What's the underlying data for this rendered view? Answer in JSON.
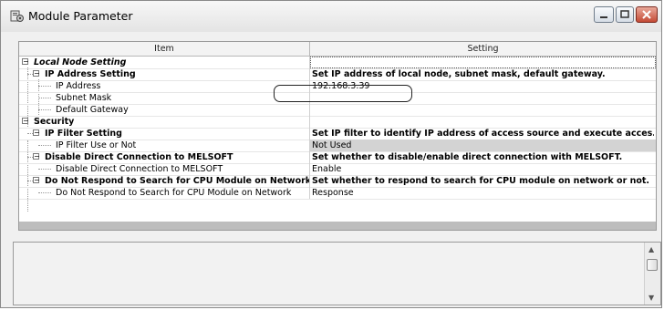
{
  "window": {
    "title": "Module Parameter",
    "icon": "module-parameter-icon"
  },
  "grid": {
    "header": {
      "item": "Item",
      "setting": "Setting"
    },
    "rows": [
      {
        "label": "Local Node Setting",
        "setting": ""
      },
      {
        "label": "IP Address Setting",
        "setting": "Set IP address of local node, subnet mask, default gateway."
      },
      {
        "label": "IP Address",
        "setting": "192.168.3.39"
      },
      {
        "label": "Subnet Mask",
        "setting": ""
      },
      {
        "label": "Default Gateway",
        "setting": ""
      },
      {
        "label": "Security",
        "setting": ""
      },
      {
        "label": "IP Filter Setting",
        "setting": "Set IP filter to identify IP address of access source and execute acces..."
      },
      {
        "label": "IP Filter Use or Not",
        "setting": "Not Used"
      },
      {
        "label": "Disable Direct Connection to MELSOFT",
        "setting": "Set whether to disable/enable direct connection with MELSOFT."
      },
      {
        "label": "Disable Direct Connection to MELSOFT",
        "setting": "Enable"
      },
      {
        "label": "Do Not Respond to Search for CPU Module on Network",
        "setting": "Set whether to respond to search for CPU module on network or not."
      },
      {
        "label": "Do Not Respond to Search for CPU Module on Network",
        "setting": "Response"
      }
    ]
  },
  "tree_toggle": "−",
  "scrollbar": {
    "up": "▲",
    "down": "▼"
  },
  "colors": {
    "selected_row": "#d3d3d3",
    "footer_bar": "#bdbdbd"
  }
}
